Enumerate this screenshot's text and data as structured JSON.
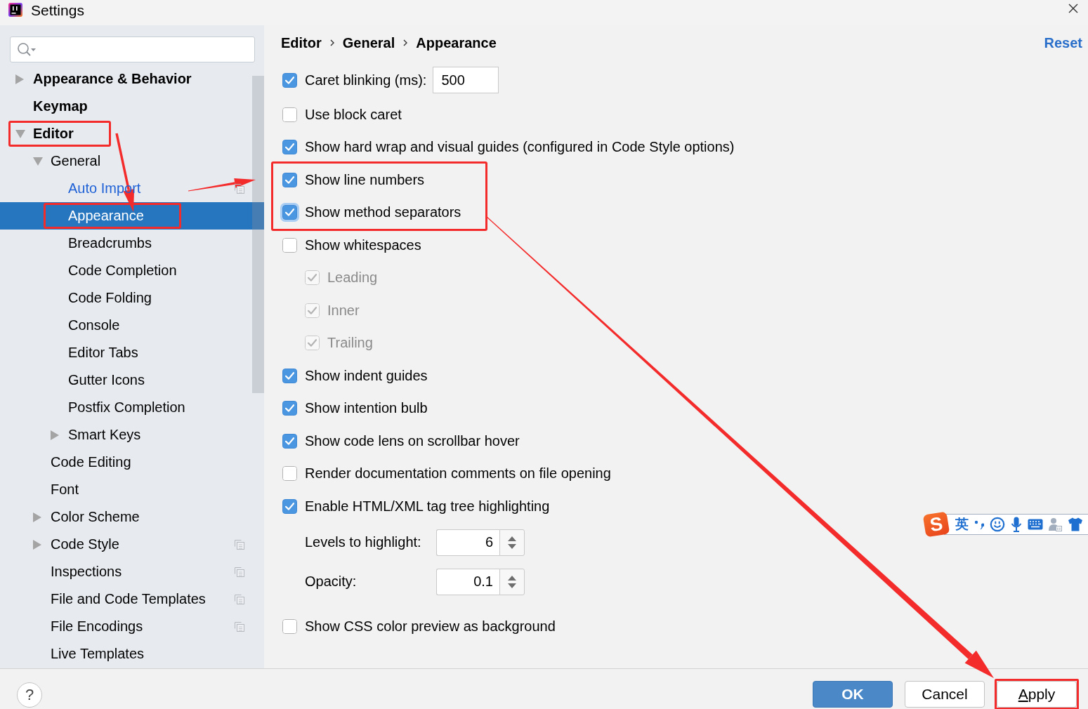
{
  "window": {
    "title": "Settings"
  },
  "sidebar": {
    "tree": [
      {
        "label": "Appearance & Behavior",
        "expanded": false,
        "selected": false,
        "modified": false,
        "scoped": false,
        "marked": false
      },
      {
        "label": "Keymap",
        "selected": false,
        "modified": false,
        "scoped": false,
        "marked": false
      },
      {
        "label": "Editor",
        "expanded": true,
        "selected": false,
        "modified": false,
        "scoped": false,
        "marked": true,
        "children": [
          {
            "label": "General",
            "expanded": true,
            "selected": false,
            "modified": false,
            "scoped": false,
            "marked": false,
            "children": [
              {
                "label": "Auto Import",
                "selected": false,
                "modified": true,
                "scoped": true,
                "marked": false
              },
              {
                "label": "Appearance",
                "selected": true,
                "modified": false,
                "scoped": false,
                "marked": true
              },
              {
                "label": "Breadcrumbs",
                "selected": false,
                "modified": false,
                "scoped": false,
                "marked": false
              },
              {
                "label": "Code Completion",
                "selected": false,
                "modified": false,
                "scoped": false,
                "marked": false
              },
              {
                "label": "Code Folding",
                "selected": false,
                "modified": false,
                "scoped": false,
                "marked": false
              },
              {
                "label": "Console",
                "selected": false,
                "modified": false,
                "scoped": false,
                "marked": false
              },
              {
                "label": "Editor Tabs",
                "selected": false,
                "modified": false,
                "scoped": false,
                "marked": false
              },
              {
                "label": "Gutter Icons",
                "selected": false,
                "modified": false,
                "scoped": false,
                "marked": false
              },
              {
                "label": "Postfix Completion",
                "selected": false,
                "modified": false,
                "scoped": false,
                "marked": false
              },
              {
                "label": "Smart Keys",
                "expanded": false,
                "selected": false,
                "modified": false,
                "scoped": false,
                "marked": false
              }
            ]
          },
          {
            "label": "Code Editing",
            "selected": false,
            "modified": false,
            "scoped": false,
            "marked": false
          },
          {
            "label": "Font",
            "selected": false,
            "modified": false,
            "scoped": false,
            "marked": false
          },
          {
            "label": "Color Scheme",
            "expanded": false,
            "selected": false,
            "modified": false,
            "scoped": false,
            "marked": false
          },
          {
            "label": "Code Style",
            "expanded": false,
            "selected": false,
            "modified": false,
            "scoped": true,
            "marked": false
          },
          {
            "label": "Inspections",
            "selected": false,
            "modified": false,
            "scoped": true,
            "marked": false
          },
          {
            "label": "File and Code Templates",
            "selected": false,
            "modified": false,
            "scoped": true,
            "marked": false
          },
          {
            "label": "File Encodings",
            "selected": false,
            "modified": false,
            "scoped": true,
            "marked": false
          },
          {
            "label": "Live Templates",
            "selected": false,
            "modified": false,
            "scoped": false,
            "marked": false
          }
        ]
      }
    ]
  },
  "breadcrumb": [
    "Editor",
    "General",
    "Appearance"
  ],
  "reset_link": "Reset",
  "options": [
    {
      "kind": "checkbox",
      "label": "Caret blinking (ms):",
      "value": "500",
      "checked": true,
      "disabled": false,
      "focused": false,
      "marked": false
    },
    {
      "kind": "checkbox",
      "label": "Use block caret",
      "checked": false,
      "disabled": false,
      "focused": false,
      "marked": false
    },
    {
      "kind": "checkbox",
      "label": "Show hard wrap and visual guides (configured in Code Style options)",
      "checked": true,
      "disabled": false,
      "focused": false,
      "marked": false
    },
    {
      "kind": "checkbox",
      "label": "Show line numbers",
      "checked": true,
      "disabled": false,
      "focused": false,
      "marked": true
    },
    {
      "kind": "checkbox",
      "label": "Show method separators",
      "checked": true,
      "disabled": false,
      "focused": true,
      "marked": true
    },
    {
      "kind": "checkbox",
      "label": "Show whitespaces",
      "checked": false,
      "disabled": false,
      "focused": false,
      "marked": false,
      "children": [
        {
          "kind": "checkbox",
          "label": "Leading",
          "checked": true,
          "disabled": true,
          "focused": false
        },
        {
          "kind": "checkbox",
          "label": "Inner",
          "checked": true,
          "disabled": true,
          "focused": false
        },
        {
          "kind": "checkbox",
          "label": "Trailing",
          "checked": true,
          "disabled": true,
          "focused": false
        }
      ]
    },
    {
      "kind": "checkbox",
      "label": "Show indent guides",
      "checked": true,
      "disabled": false,
      "focused": false,
      "marked": false
    },
    {
      "kind": "checkbox",
      "label": "Show intention bulb",
      "checked": true,
      "disabled": false,
      "focused": false,
      "marked": false
    },
    {
      "kind": "checkbox",
      "label": "Show code lens on scrollbar hover",
      "checked": true,
      "disabled": false,
      "focused": false,
      "marked": false
    },
    {
      "kind": "checkbox",
      "label": "Render documentation comments on file opening",
      "checked": false,
      "disabled": false,
      "focused": false,
      "marked": false
    },
    {
      "kind": "checkbox",
      "label": "Enable HTML/XML tag tree highlighting",
      "checked": true,
      "disabled": false,
      "focused": false,
      "marked": false,
      "children": [
        {
          "kind": "spinner",
          "label": "Levels to highlight:",
          "value": "6"
        },
        {
          "kind": "spinner",
          "label": "Opacity:",
          "value": "0.1"
        }
      ]
    },
    {
      "kind": "checkbox",
      "label": "Show CSS color preview as background",
      "checked": false,
      "disabled": false,
      "focused": false,
      "marked": false
    }
  ],
  "footer": {
    "help_button": "?",
    "buttons": [
      {
        "label": "OK",
        "default": true,
        "mnemonic": false,
        "marked": false
      },
      {
        "label": "Cancel",
        "default": false,
        "mnemonic": false,
        "marked": false
      },
      {
        "label": "Apply",
        "default": false,
        "mnemonic": true,
        "marked": true
      }
    ]
  },
  "ime_toolbar": {
    "logo": "S",
    "mode": "英"
  }
}
